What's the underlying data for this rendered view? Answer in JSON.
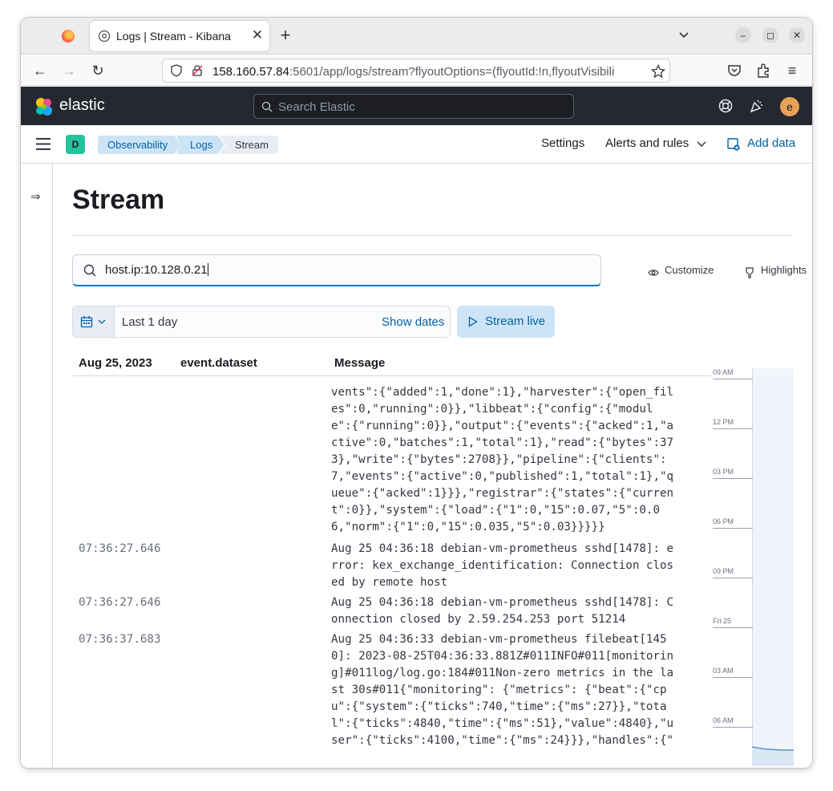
{
  "browser": {
    "tab_title": "Logs | Stream - Kibana",
    "url_host": "158.160.57.84",
    "url_rest": ":5601/app/logs/stream?flyoutOptions=(flyoutId:!n,flyoutVisibili"
  },
  "kibana_header": {
    "brand": "elastic",
    "search_placeholder": "Search Elastic",
    "avatar_letter": "e",
    "accent": "#e7a258"
  },
  "subheader": {
    "space_letter": "D",
    "breadcrumbs": [
      "Observability",
      "Logs",
      "Stream"
    ],
    "settings": "Settings",
    "alerts": "Alerts and rules",
    "add_data": "Add data"
  },
  "page": {
    "title": "Stream",
    "query": "host.ip:10.128.0.21",
    "customize": "Customize",
    "highlights": "Highlights",
    "range": "Last 1 day",
    "show_dates": "Show dates",
    "stream_live": "Stream live"
  },
  "table": {
    "col_date": "Aug 25, 2023",
    "col_dataset": "event.dataset",
    "col_message": "Message",
    "rows": [
      {
        "ts": "",
        "lines": [
          "vents\":{\"added\":1,\"done\":1},\"harvester\":{\"open_fil",
          "es\":0,\"running\":0}},\"libbeat\":{\"config\":{\"modul",
          "e\":{\"running\":0}},\"output\":{\"events\":{\"acked\":1,\"a",
          "ctive\":0,\"batches\":1,\"total\":1},\"read\":{\"bytes\":37",
          "3},\"write\":{\"bytes\":2708}},\"pipeline\":{\"clients\":",
          "7,\"events\":{\"active\":0,\"published\":1,\"total\":1},\"q",
          "ueue\":{\"acked\":1}}},\"registrar\":{\"states\":{\"curren",
          "t\":0}},\"system\":{\"load\":{\"1\":0,\"15\":0.07,\"5\":0.0",
          "6,\"norm\":{\"1\":0,\"15\":0.035,\"5\":0.03}}}}}"
        ]
      },
      {
        "ts": "07:36:27.646",
        "lines": [
          "Aug 25 04:36:18 debian-vm-prometheus sshd[1478]: e",
          "rror: kex_exchange_identification: Connection clos",
          "ed by remote host"
        ]
      },
      {
        "ts": "07:36:27.646",
        "lines": [
          "Aug 25 04:36:18 debian-vm-prometheus sshd[1478]: C",
          "onnection closed by 2.59.254.253 port 51214"
        ]
      },
      {
        "ts": "07:36:37.683",
        "lines": [
          "Aug 25 04:36:33 debian-vm-prometheus filebeat[145",
          "0]: 2023-08-25T04:36:33.881Z#011INFO#011[monitorin",
          "g]#011log/log.go:184#011Non-zero metrics in the la",
          "st 30s#011{\"monitoring\": {\"metrics\": {\"beat\":{\"cp",
          "u\":{\"system\":{\"ticks\":740,\"time\":{\"ms\":27}},\"tota",
          "l\":{\"ticks\":4840,\"time\":{\"ms\":51},\"value\":4840},\"u",
          "ser\":{\"ticks\":4100,\"time\":{\"ms\":24}}},\"handles\":{\""
        ]
      }
    ]
  },
  "minimap": {
    "labels": [
      "09 AM",
      "12 PM",
      "03 PM",
      "06 PM",
      "09 PM",
      "Fri 25",
      "03 AM",
      "06 AM"
    ]
  }
}
